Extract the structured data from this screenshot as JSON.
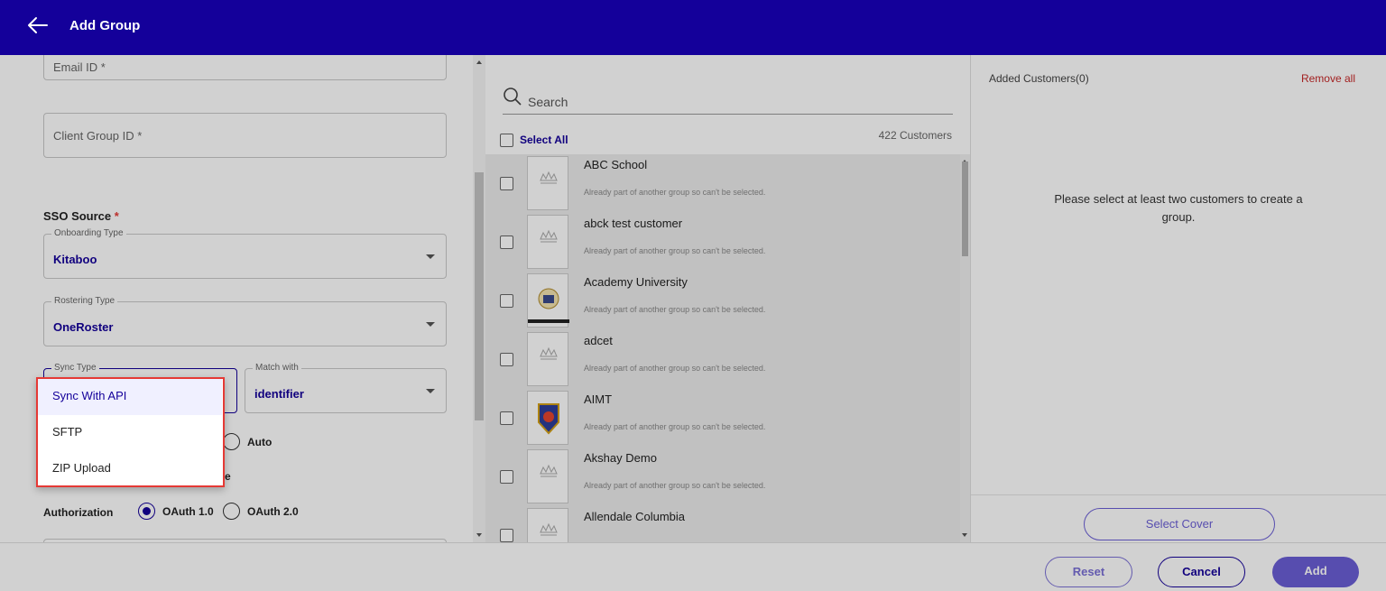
{
  "header": {
    "title": "Add Group"
  },
  "form": {
    "email_placeholder": "Email ID *",
    "client_group_placeholder": "Client Group ID *",
    "sso_source_label": "SSO Source",
    "required_mark": "*",
    "onboarding_type": {
      "legend": "Onboarding Type",
      "value": "Kitaboo"
    },
    "rostering_type": {
      "legend": "Rostering Type",
      "value": "OneRoster"
    },
    "sync_type": {
      "legend": "Sync Type"
    },
    "match_with": {
      "legend": "Match with",
      "value": "identifier"
    },
    "auto_label": "Auto",
    "partial_letter": "e",
    "authorization": {
      "label": "Authorization",
      "options": [
        "OAuth 1.0",
        "OAuth 2.0"
      ],
      "selected": "OAuth 1.0"
    }
  },
  "sync_dropdown": {
    "options": [
      "Sync With API",
      "SFTP",
      "ZIP Upload"
    ],
    "selected": "Sync With API"
  },
  "customers": {
    "search_placeholder": "Search",
    "select_all": "Select All",
    "count_label": "422 Customers",
    "note": "Already part of another group so can't be selected.",
    "items": [
      {
        "name": "ABC School"
      },
      {
        "name": "abck test customer"
      },
      {
        "name": "Academy University"
      },
      {
        "name": "adcet"
      },
      {
        "name": "AIMT"
      },
      {
        "name": "Akshay Demo"
      },
      {
        "name": "Allendale Columbia"
      }
    ]
  },
  "added": {
    "title": "Added Customers(0)",
    "remove_all": "Remove all",
    "empty_message": "Please select at least two customers to create a group.",
    "select_cover": "Select Cover"
  },
  "footer": {
    "reset": "Reset",
    "cancel": "Cancel",
    "add": "Add"
  },
  "colors": {
    "primary": "#14009a",
    "accent": "#6b5fd6",
    "danger": "#e53935"
  }
}
